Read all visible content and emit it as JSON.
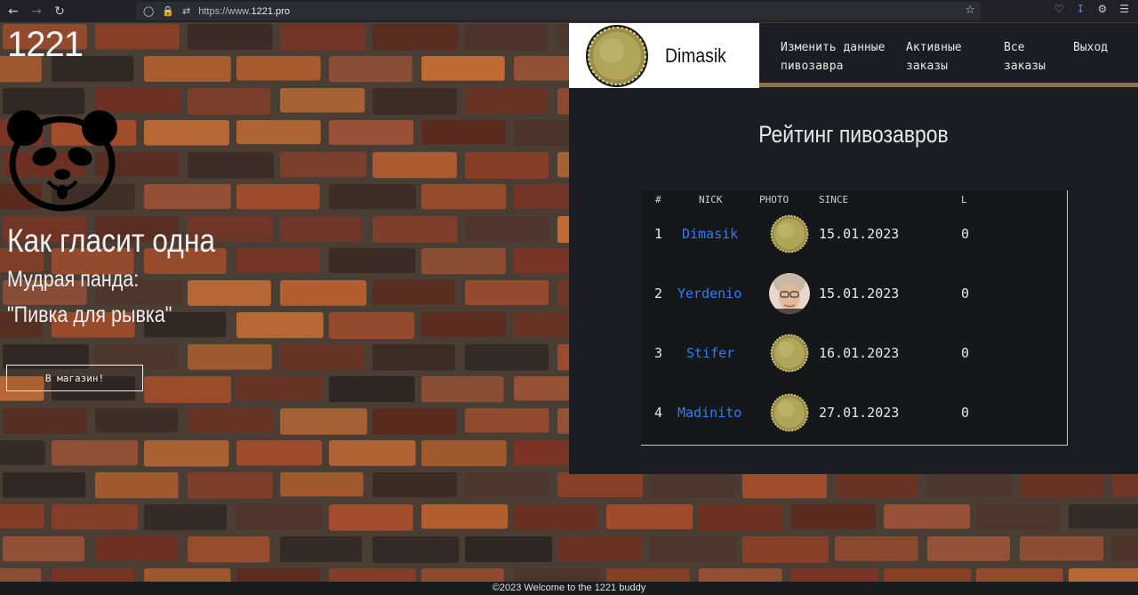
{
  "browser": {
    "url_prefix": "https://www.",
    "url_domain": "1221.pro",
    "icons": [
      "back-icon",
      "forward-icon",
      "reload-icon",
      "shield-icon",
      "lock-icon",
      "permissions-icon",
      "star-icon",
      "pocket-icon",
      "download-icon",
      "extension-icon",
      "menu-icon"
    ]
  },
  "hero": {
    "logo": "1221",
    "quote_line1": "Как гласит одна",
    "quote_line2": "Мудрая панда:",
    "quote_line3": "\"Пивка для рывка\"",
    "shop_button": "В магазин!"
  },
  "profile": {
    "username": "Dimasik"
  },
  "nav": {
    "edit_profile": "Изменить данные\nпивозавра",
    "active_orders": "Активные\nзаказы",
    "all_orders": "Все\nзаказы",
    "logout": "Выход"
  },
  "rating": {
    "title": "Рейтинг пивозавров",
    "columns": [
      "#",
      "NICK",
      "PHOTO",
      "SINCE",
      "L"
    ],
    "rows": [
      {
        "rank": "1",
        "nick": "Dimasik",
        "photo": "bottle-cap",
        "since": "15.01.2023",
        "l": "0"
      },
      {
        "rank": "2",
        "nick": "Yerdenio",
        "photo": "person-photo",
        "since": "15.01.2023",
        "l": "0"
      },
      {
        "rank": "3",
        "nick": "Stifer",
        "photo": "bottle-cap",
        "since": "16.01.2023",
        "l": "0"
      },
      {
        "rank": "4",
        "nick": "Madinito",
        "photo": "bottle-cap",
        "since": "27.01.2023",
        "l": "0"
      }
    ]
  },
  "footer": {
    "text": "©2023 Welcome to the 1221 buddy"
  },
  "colors": {
    "link": "#2e7cf6",
    "panel": "#1c1d22",
    "accent_line": "#8a7448"
  }
}
